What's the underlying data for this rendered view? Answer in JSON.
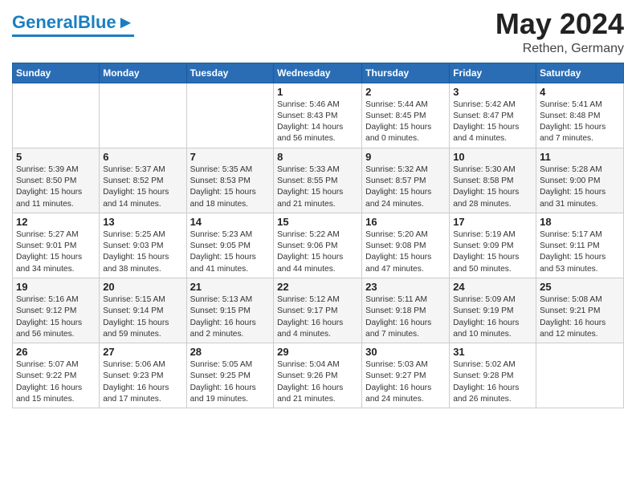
{
  "header": {
    "logo_general": "General",
    "logo_blue": "Blue",
    "month": "May 2024",
    "location": "Rethen, Germany"
  },
  "days_of_week": [
    "Sunday",
    "Monday",
    "Tuesday",
    "Wednesday",
    "Thursday",
    "Friday",
    "Saturday"
  ],
  "weeks": [
    [
      {
        "day": "",
        "info": ""
      },
      {
        "day": "",
        "info": ""
      },
      {
        "day": "",
        "info": ""
      },
      {
        "day": "1",
        "info": "Sunrise: 5:46 AM\nSunset: 8:43 PM\nDaylight: 14 hours\nand 56 minutes."
      },
      {
        "day": "2",
        "info": "Sunrise: 5:44 AM\nSunset: 8:45 PM\nDaylight: 15 hours\nand 0 minutes."
      },
      {
        "day": "3",
        "info": "Sunrise: 5:42 AM\nSunset: 8:47 PM\nDaylight: 15 hours\nand 4 minutes."
      },
      {
        "day": "4",
        "info": "Sunrise: 5:41 AM\nSunset: 8:48 PM\nDaylight: 15 hours\nand 7 minutes."
      }
    ],
    [
      {
        "day": "5",
        "info": "Sunrise: 5:39 AM\nSunset: 8:50 PM\nDaylight: 15 hours\nand 11 minutes."
      },
      {
        "day": "6",
        "info": "Sunrise: 5:37 AM\nSunset: 8:52 PM\nDaylight: 15 hours\nand 14 minutes."
      },
      {
        "day": "7",
        "info": "Sunrise: 5:35 AM\nSunset: 8:53 PM\nDaylight: 15 hours\nand 18 minutes."
      },
      {
        "day": "8",
        "info": "Sunrise: 5:33 AM\nSunset: 8:55 PM\nDaylight: 15 hours\nand 21 minutes."
      },
      {
        "day": "9",
        "info": "Sunrise: 5:32 AM\nSunset: 8:57 PM\nDaylight: 15 hours\nand 24 minutes."
      },
      {
        "day": "10",
        "info": "Sunrise: 5:30 AM\nSunset: 8:58 PM\nDaylight: 15 hours\nand 28 minutes."
      },
      {
        "day": "11",
        "info": "Sunrise: 5:28 AM\nSunset: 9:00 PM\nDaylight: 15 hours\nand 31 minutes."
      }
    ],
    [
      {
        "day": "12",
        "info": "Sunrise: 5:27 AM\nSunset: 9:01 PM\nDaylight: 15 hours\nand 34 minutes."
      },
      {
        "day": "13",
        "info": "Sunrise: 5:25 AM\nSunset: 9:03 PM\nDaylight: 15 hours\nand 38 minutes."
      },
      {
        "day": "14",
        "info": "Sunrise: 5:23 AM\nSunset: 9:05 PM\nDaylight: 15 hours\nand 41 minutes."
      },
      {
        "day": "15",
        "info": "Sunrise: 5:22 AM\nSunset: 9:06 PM\nDaylight: 15 hours\nand 44 minutes."
      },
      {
        "day": "16",
        "info": "Sunrise: 5:20 AM\nSunset: 9:08 PM\nDaylight: 15 hours\nand 47 minutes."
      },
      {
        "day": "17",
        "info": "Sunrise: 5:19 AM\nSunset: 9:09 PM\nDaylight: 15 hours\nand 50 minutes."
      },
      {
        "day": "18",
        "info": "Sunrise: 5:17 AM\nSunset: 9:11 PM\nDaylight: 15 hours\nand 53 minutes."
      }
    ],
    [
      {
        "day": "19",
        "info": "Sunrise: 5:16 AM\nSunset: 9:12 PM\nDaylight: 15 hours\nand 56 minutes."
      },
      {
        "day": "20",
        "info": "Sunrise: 5:15 AM\nSunset: 9:14 PM\nDaylight: 15 hours\nand 59 minutes."
      },
      {
        "day": "21",
        "info": "Sunrise: 5:13 AM\nSunset: 9:15 PM\nDaylight: 16 hours\nand 2 minutes."
      },
      {
        "day": "22",
        "info": "Sunrise: 5:12 AM\nSunset: 9:17 PM\nDaylight: 16 hours\nand 4 minutes."
      },
      {
        "day": "23",
        "info": "Sunrise: 5:11 AM\nSunset: 9:18 PM\nDaylight: 16 hours\nand 7 minutes."
      },
      {
        "day": "24",
        "info": "Sunrise: 5:09 AM\nSunset: 9:19 PM\nDaylight: 16 hours\nand 10 minutes."
      },
      {
        "day": "25",
        "info": "Sunrise: 5:08 AM\nSunset: 9:21 PM\nDaylight: 16 hours\nand 12 minutes."
      }
    ],
    [
      {
        "day": "26",
        "info": "Sunrise: 5:07 AM\nSunset: 9:22 PM\nDaylight: 16 hours\nand 15 minutes."
      },
      {
        "day": "27",
        "info": "Sunrise: 5:06 AM\nSunset: 9:23 PM\nDaylight: 16 hours\nand 17 minutes."
      },
      {
        "day": "28",
        "info": "Sunrise: 5:05 AM\nSunset: 9:25 PM\nDaylight: 16 hours\nand 19 minutes."
      },
      {
        "day": "29",
        "info": "Sunrise: 5:04 AM\nSunset: 9:26 PM\nDaylight: 16 hours\nand 21 minutes."
      },
      {
        "day": "30",
        "info": "Sunrise: 5:03 AM\nSunset: 9:27 PM\nDaylight: 16 hours\nand 24 minutes."
      },
      {
        "day": "31",
        "info": "Sunrise: 5:02 AM\nSunset: 9:28 PM\nDaylight: 16 hours\nand 26 minutes."
      },
      {
        "day": "",
        "info": ""
      }
    ]
  ]
}
